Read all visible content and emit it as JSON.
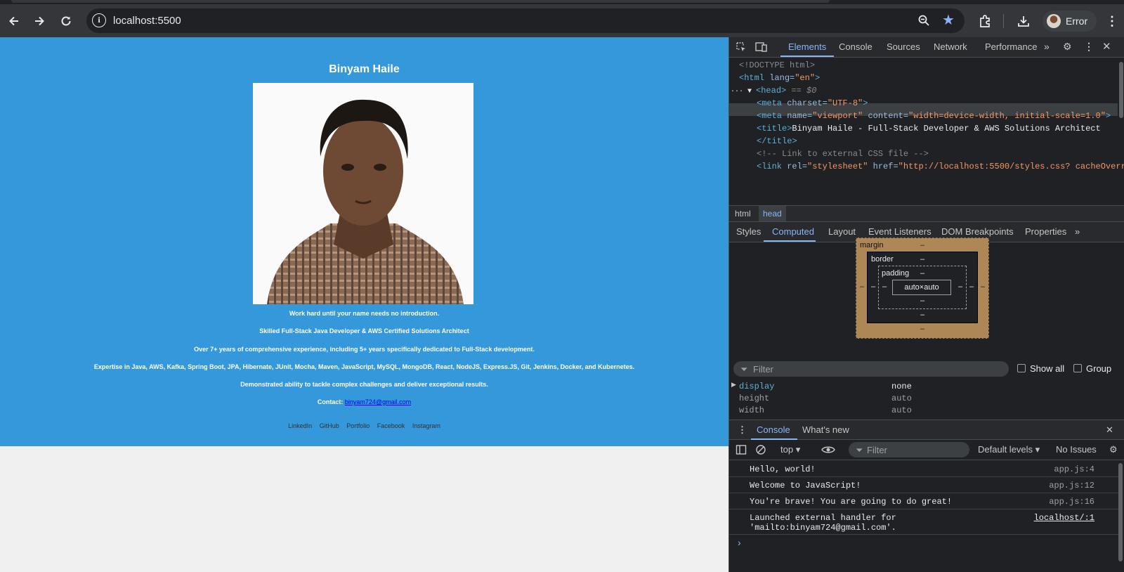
{
  "browser": {
    "url": "localhost:5500",
    "profile_label": "Error",
    "icons": [
      "back-icon",
      "forward-icon",
      "reload-icon",
      "info-icon",
      "zoom-icon",
      "star-icon",
      "extensions-icon",
      "downloads-icon",
      "menu-icon"
    ]
  },
  "page": {
    "name": "Binyam Haile",
    "lines": [
      "Work hard until your name needs no introduction.",
      "Skilled Full-Stack Java Developer & AWS Certified Solutions Architect",
      "Over 7+ years of comprehensive experience, including 5+ years specifically dedicated to Full-Stack development.",
      "Expertise in Java, AWS, Kafka, Spring Boot, JPA, Hibernate, JUnit, Mocha, Maven, JavaScript, MySQL, MongoDB, React, NodeJS, Express.JS, Git, Jenkins, Docker, and Kubernetes.",
      "Demonstrated ability to tackle complex challenges and deliver exceptional results."
    ],
    "contact_label": "Contact:",
    "contact_email": "binyam724@gmail.com",
    "links": [
      "LinkedIn",
      "GitHub",
      "Portfolio",
      "Facebook",
      "Instagram"
    ],
    "colors": {
      "hero_bg": "#3498db",
      "page_bg": "#f0f0f0"
    }
  },
  "devtools": {
    "tabs": [
      "Elements",
      "Console",
      "Sources",
      "Network",
      "Performance"
    ],
    "active_tab": "Elements",
    "dom_lines": {
      "doctype": "<!DOCTYPE html>",
      "html_open_tag": "<html",
      "html_lang_attr": " lang=",
      "html_lang_val": "\"en\"",
      "close_gt": ">",
      "head_tag": "<head>",
      "head_marker": " == $0",
      "meta1_tag": "<meta",
      "meta1_attr": " charset=",
      "meta1_val": "\"UTF-8\"",
      "meta2_tag": "<meta",
      "meta2_attr1": " name=",
      "meta2_val1": "\"viewport\"",
      "meta2_attr2": " content=",
      "meta2_val2": "\"width=device-width, initial-scale=1.0\"",
      "title_open": "<title>",
      "title_text": "Binyam Haile - Full-Stack Developer & AWS Solutions Architect",
      "title_close": "</title>",
      "comment": "<!-- Link to external CSS file -->",
      "link_tag": "<link",
      "link_attr1": " rel=",
      "link_val1": "\"stylesheet\"",
      "link_attr2": " href=",
      "link_val2": "\"http://localhost:5500/styles.css? cacheOverr"
    },
    "breadcrumbs": [
      "html",
      "head"
    ],
    "sub_tabs": [
      "Styles",
      "Computed",
      "Layout",
      "Event Listeners",
      "DOM Breakpoints",
      "Properties"
    ],
    "active_sub_tab": "Computed",
    "box_model": {
      "margin_label": "margin",
      "border_label": "border",
      "padding_label": "padding",
      "content": "auto×auto",
      "dash": "–"
    },
    "filter_placeholder": "Filter",
    "show_all_label": "Show all",
    "group_label": "Group",
    "computed": [
      {
        "prop": "display",
        "value": "none"
      },
      {
        "prop": "height",
        "value": "auto"
      },
      {
        "prop": "width",
        "value": "auto"
      }
    ],
    "drawer_tabs": [
      "Console",
      "What's new"
    ],
    "console_context": "top",
    "console_filter": "Filter",
    "levels": "Default levels",
    "issues": "No Issues",
    "console_rows": [
      {
        "msg": "Hello, world!",
        "src": "app.js:4"
      },
      {
        "msg": "Welcome to JavaScript!",
        "src": "app.js:12"
      },
      {
        "msg": "You're brave! You are going to do great!",
        "src": "app.js:16"
      },
      {
        "msg": "Launched external handler for\n'mailto:binyam724@gmail.com'.",
        "src": "localhost/:1"
      }
    ]
  }
}
